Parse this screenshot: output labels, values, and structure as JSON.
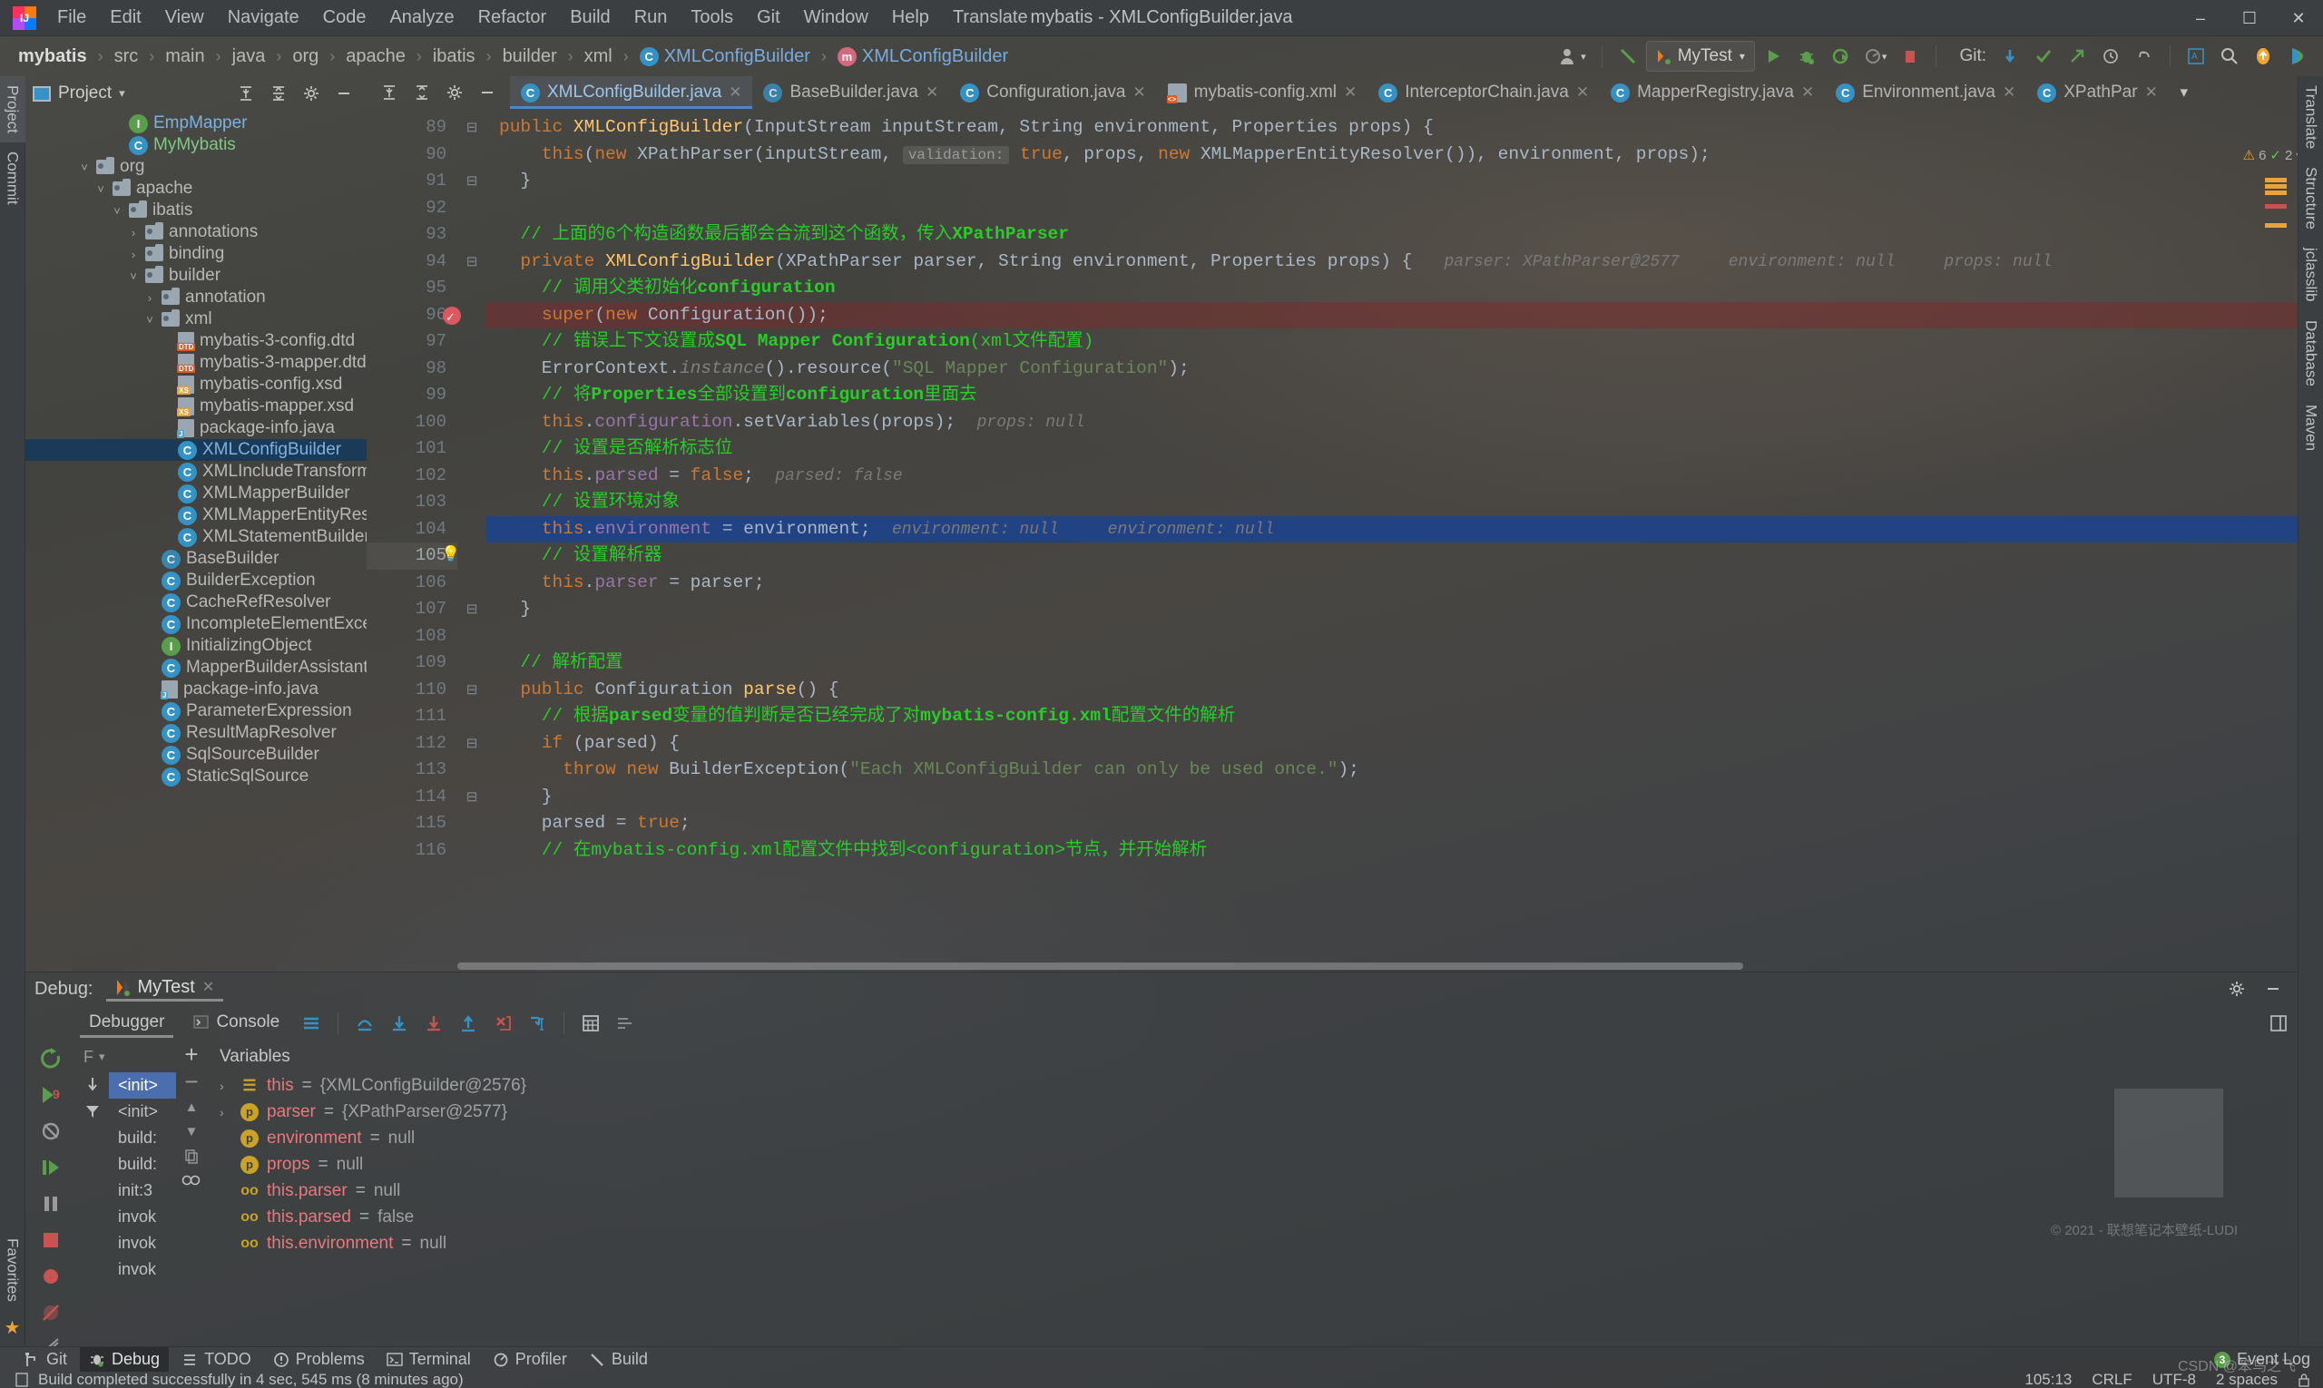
{
  "window": {
    "title": "mybatis - XMLConfigBuilder.java",
    "minimize": "–",
    "maximize": "☐",
    "close": "✕"
  },
  "menu": {
    "items": [
      "File",
      "Edit",
      "View",
      "Navigate",
      "Code",
      "Analyze",
      "Refactor",
      "Build",
      "Run",
      "Tools",
      "Git",
      "Window",
      "Help",
      "Translate"
    ]
  },
  "breadcrumb": {
    "items": [
      {
        "label": "mybatis",
        "kind": "project"
      },
      {
        "label": "src",
        "kind": "folder"
      },
      {
        "label": "main",
        "kind": "folder"
      },
      {
        "label": "java",
        "kind": "folder"
      },
      {
        "label": "org",
        "kind": "folder"
      },
      {
        "label": "apache",
        "kind": "folder"
      },
      {
        "label": "ibatis",
        "kind": "folder"
      },
      {
        "label": "builder",
        "kind": "folder"
      },
      {
        "label": "xml",
        "kind": "folder"
      },
      {
        "label": "XMLConfigBuilder",
        "kind": "class"
      },
      {
        "label": "XMLConfigBuilder",
        "kind": "method"
      }
    ]
  },
  "toolbar": {
    "run_config": "MyTest",
    "git_label": "Git:",
    "class_icon_letter": "C",
    "method_icon_letter": "m",
    "interface_icon_letter": "I"
  },
  "left_strip": {
    "tabs": [
      "Project",
      "Commit"
    ],
    "bottom_tabs": [
      "Favorites"
    ]
  },
  "right_strip": {
    "tabs": [
      "Translate",
      "Structure",
      "jclasslib",
      "Database",
      "Maven"
    ]
  },
  "project_panel": {
    "title": "Project",
    "tree": [
      {
        "indent": 5,
        "arrow": "",
        "icon": "interface",
        "label": "EmpMapper",
        "color": "blue"
      },
      {
        "indent": 5,
        "arrow": "",
        "icon": "run-class",
        "label": "MyMybatis",
        "color": "green"
      },
      {
        "indent": 3,
        "arrow": "v",
        "icon": "folder",
        "label": "org",
        "color": "plain"
      },
      {
        "indent": 4,
        "arrow": "v",
        "icon": "folder",
        "label": "apache",
        "color": "plain"
      },
      {
        "indent": 5,
        "arrow": "v",
        "icon": "folder",
        "label": "ibatis",
        "color": "plain"
      },
      {
        "indent": 6,
        "arrow": ">",
        "icon": "folder",
        "label": "annotations",
        "color": "plain"
      },
      {
        "indent": 6,
        "arrow": ">",
        "icon": "folder",
        "label": "binding",
        "color": "plain"
      },
      {
        "indent": 6,
        "arrow": "v",
        "icon": "folder",
        "label": "builder",
        "color": "plain"
      },
      {
        "indent": 7,
        "arrow": ">",
        "icon": "folder",
        "label": "annotation",
        "color": "plain"
      },
      {
        "indent": 7,
        "arrow": "v",
        "icon": "folder",
        "label": "xml",
        "color": "plain"
      },
      {
        "indent": 8,
        "arrow": "",
        "icon": "dtd",
        "label": "mybatis-3-config.dtd",
        "color": "plain"
      },
      {
        "indent": 8,
        "arrow": "",
        "icon": "dtd",
        "label": "mybatis-3-mapper.dtd",
        "color": "plain"
      },
      {
        "indent": 8,
        "arrow": "",
        "icon": "xsd",
        "label": "mybatis-config.xsd",
        "color": "plain"
      },
      {
        "indent": 8,
        "arrow": "",
        "icon": "xsd",
        "label": "mybatis-mapper.xsd",
        "color": "plain"
      },
      {
        "indent": 8,
        "arrow": "",
        "icon": "java-file",
        "label": "package-info.java",
        "color": "plain"
      },
      {
        "indent": 8,
        "arrow": "",
        "icon": "class",
        "label": "XMLConfigBuilder",
        "color": "blue",
        "selected": true
      },
      {
        "indent": 8,
        "arrow": "",
        "icon": "class",
        "label": "XMLIncludeTransformer",
        "color": "plain"
      },
      {
        "indent": 8,
        "arrow": "",
        "icon": "class",
        "label": "XMLMapperBuilder",
        "color": "plain"
      },
      {
        "indent": 8,
        "arrow": "",
        "icon": "class",
        "label": "XMLMapperEntityResolver",
        "color": "plain"
      },
      {
        "indent": 8,
        "arrow": "",
        "icon": "class",
        "label": "XMLStatementBuilder",
        "color": "plain"
      },
      {
        "indent": 7,
        "arrow": "",
        "icon": "abstract-class",
        "label": "BaseBuilder",
        "color": "plain"
      },
      {
        "indent": 7,
        "arrow": "",
        "icon": "class",
        "label": "BuilderException",
        "color": "plain"
      },
      {
        "indent": 7,
        "arrow": "",
        "icon": "class",
        "label": "CacheRefResolver",
        "color": "plain"
      },
      {
        "indent": 7,
        "arrow": "",
        "icon": "class",
        "label": "IncompleteElementException",
        "color": "plain"
      },
      {
        "indent": 7,
        "arrow": "",
        "icon": "interface",
        "label": "InitializingObject",
        "color": "plain"
      },
      {
        "indent": 7,
        "arrow": "",
        "icon": "class",
        "label": "MapperBuilderAssistant",
        "color": "plain"
      },
      {
        "indent": 7,
        "arrow": "",
        "icon": "java-file",
        "label": "package-info.java",
        "color": "plain"
      },
      {
        "indent": 7,
        "arrow": "",
        "icon": "class",
        "label": "ParameterExpression",
        "color": "plain"
      },
      {
        "indent": 7,
        "arrow": "",
        "icon": "class",
        "label": "ResultMapResolver",
        "color": "plain"
      },
      {
        "indent": 7,
        "arrow": "",
        "icon": "class",
        "label": "SqlSourceBuilder",
        "color": "plain"
      },
      {
        "indent": 7,
        "arrow": "",
        "icon": "class",
        "label": "StaticSqlSource",
        "color": "plain"
      }
    ]
  },
  "editor": {
    "tabs": [
      {
        "label": "XMLConfigBuilder.java",
        "icon": "class",
        "active": true
      },
      {
        "label": "BaseBuilder.java",
        "icon": "abstract-class",
        "active": false
      },
      {
        "label": "Configuration.java",
        "icon": "class",
        "active": false
      },
      {
        "label": "mybatis-config.xml",
        "icon": "xml",
        "active": false
      },
      {
        "label": "InterceptorChain.java",
        "icon": "class",
        "active": false
      },
      {
        "label": "MapperRegistry.java",
        "icon": "class",
        "active": false
      },
      {
        "label": "Environment.java",
        "icon": "class",
        "active": false
      },
      {
        "label": "XPathPar",
        "icon": "class",
        "active": false
      }
    ],
    "inspection": {
      "warnings": "6",
      "errors": "2",
      "warn_symbol": "⚠",
      "ok_symbol": "✓"
    },
    "first_line_number": 89,
    "lines": [
      {
        "n": 89,
        "fold": "⊟",
        "html": "<span class=\"kw\">public</span> <span class=\"cls2\">XMLConfigBuilder</span>(InputStream inputStream, String environment, Properties props) {"
      },
      {
        "n": 90,
        "fold": "",
        "html": "    <span class=\"kw\">this</span>(<span class=\"kw\">new</span> XPathParser(inputStream, <span class=\"hint\">validation:</span> <span class=\"kw\">true</span>, props, <span class=\"kw\">new</span> XMLMapperEntityResolver()), environment, props);"
      },
      {
        "n": 91,
        "fold": "⊟",
        "html": "  }"
      },
      {
        "n": 92,
        "fold": "",
        "html": ""
      },
      {
        "n": 93,
        "fold": "",
        "html": "  <span class=\"cmt\">// 上面的6个构造函数最后都会合流到这个函数，传入<b>XPathParser</b></span>"
      },
      {
        "n": 94,
        "fold": "⊟",
        "html": "  <span class=\"kw\">private</span> <span class=\"cls2\">XMLConfigBuilder</span>(XPathParser parser, String environment, Properties props) {   <span class=\"paramhint\">parser: XPathParser@2577     environment: null     props: null</span>"
      },
      {
        "n": 95,
        "fold": "",
        "html": "    <span class=\"cmt\">// 调用父类初始化<b>configuration</b></span>"
      },
      {
        "n": 96,
        "fold": "",
        "bp": true,
        "hl": "red",
        "html": "    <span class=\"kw\">super</span>(<span class=\"kw\">new</span> Configuration());"
      },
      {
        "n": 97,
        "fold": "",
        "html": "    <span class=\"cmt\">// 错误上下文设置成<b>SQL Mapper Configuration</b>(xml文件配置)</span>"
      },
      {
        "n": 98,
        "fold": "",
        "html": "    ErrorContext.<span class=\"ital\">instance</span>().resource(<span class=\"str\">\"SQL Mapper Configuration\"</span>);"
      },
      {
        "n": 99,
        "fold": "",
        "html": "    <span class=\"cmt\">// 将<b>Properties</b>全部设置到<b>configuration</b>里面去</span>"
      },
      {
        "n": 100,
        "fold": "",
        "html": "    <span class=\"kw\">this</span>.<span class=\"fld\">configuration</span>.setVariables(props);  <span class=\"paramhint\">props: null</span>"
      },
      {
        "n": 101,
        "fold": "",
        "html": "    <span class=\"cmt\">// 设置是否解析标志位</span>"
      },
      {
        "n": 102,
        "fold": "",
        "html": "    <span class=\"kw\">this</span>.<span class=\"fld\">parsed</span> = <span class=\"kw\">false</span>;  <span class=\"paramhint\">parsed: false</span>"
      },
      {
        "n": 103,
        "fold": "",
        "html": "    <span class=\"cmt\">// 设置环境对象</span>"
      },
      {
        "n": 104,
        "fold": "",
        "hl": "blue",
        "html": "    <span class=\"kw\">this</span>.<span class=\"fld\">environment</span> = environment;  <span class=\"paramhint\">environment: null     environment: null</span>"
      },
      {
        "n": 105,
        "fold": "",
        "bulb": true,
        "cur": true,
        "html": "    <span class=\"cmt\">// 设置解析器</span>"
      },
      {
        "n": 106,
        "fold": "",
        "html": "    <span class=\"kw\">this</span>.<span class=\"fld\">parser</span> = parser;"
      },
      {
        "n": 107,
        "fold": "⊟",
        "html": "  }"
      },
      {
        "n": 108,
        "fold": "",
        "html": ""
      },
      {
        "n": 109,
        "fold": "",
        "html": "  <span class=\"cmt\">// 解析配置</span>"
      },
      {
        "n": 110,
        "fold": "⊟",
        "html": "  <span class=\"kw\">public</span> Configuration <span class=\"mth\">parse</span>() {"
      },
      {
        "n": 111,
        "fold": "",
        "html": "    <span class=\"cmt\">// 根据<b>parsed</b>变量的值判断是否已经完成了对<b>mybatis-config.xml</b>配置文件的解析</span>"
      },
      {
        "n": 112,
        "fold": "⊟",
        "html": "    <span class=\"kw\">if</span> (parsed) {"
      },
      {
        "n": 113,
        "fold": "",
        "html": "      <span class=\"kw\">throw new</span> BuilderException(<span class=\"str\">\"Each XMLConfigBuilder can only be used once.\"</span>);"
      },
      {
        "n": 114,
        "fold": "⊟",
        "html": "    }"
      },
      {
        "n": 115,
        "fold": "",
        "html": "    parsed = <span class=\"kw\">true</span>;"
      },
      {
        "n": 116,
        "fold": "",
        "html": "    <span class=\"cmt\">// 在mybatis-config.xml配置文件中找到&lt;configuration&gt;节点，并开始解析</span>"
      }
    ]
  },
  "debug": {
    "label": "Debug:",
    "session": "MyTest",
    "tabs": [
      {
        "label": "Debugger",
        "active": true
      },
      {
        "label": "Console",
        "active": false
      }
    ],
    "frames_head": "F",
    "frames": [
      {
        "label": "<init>",
        "selected": true
      },
      {
        "label": "<init>",
        "selected": false
      },
      {
        "label": "build:",
        "selected": false
      },
      {
        "label": "build:",
        "selected": false
      },
      {
        "label": "init:3",
        "selected": false
      },
      {
        "label": "invok",
        "selected": false
      },
      {
        "label": "invok",
        "selected": false
      },
      {
        "label": "invok",
        "selected": false
      }
    ],
    "variables_header": "Variables",
    "variables": [
      {
        "arrow": ">",
        "icon": "field",
        "name": "this",
        "eq": " = ",
        "value": "{XMLConfigBuilder@2576}"
      },
      {
        "arrow": ">",
        "icon": "param",
        "name": "parser",
        "eq": " = ",
        "value": "{XPathParser@2577}"
      },
      {
        "arrow": "",
        "icon": "param",
        "name": "environment",
        "eq": " = ",
        "value": "null"
      },
      {
        "arrow": "",
        "icon": "param",
        "name": "props",
        "eq": " = ",
        "value": "null"
      },
      {
        "arrow": "",
        "icon": "oo",
        "name": "this.parser",
        "eq": " = ",
        "value": "null"
      },
      {
        "arrow": "",
        "icon": "oo",
        "name": "this.parsed",
        "eq": " = ",
        "value": "false"
      },
      {
        "arrow": "",
        "icon": "oo",
        "name": "this.environment",
        "eq": " = ",
        "value": "null"
      }
    ]
  },
  "toolwindow_bar": {
    "items": [
      {
        "label": "Git",
        "icon": "branch-icon",
        "active": false
      },
      {
        "label": "Debug",
        "icon": "bug-icon",
        "active": true
      },
      {
        "label": "TODO",
        "icon": "list-icon",
        "active": false
      },
      {
        "label": "Problems",
        "icon": "warning-icon",
        "active": false
      },
      {
        "label": "Terminal",
        "icon": "terminal-icon",
        "active": false
      },
      {
        "label": "Profiler",
        "icon": "profiler-icon",
        "active": false
      },
      {
        "label": "Build",
        "icon": "hammer-icon",
        "active": false
      }
    ],
    "event_log": "Event Log",
    "event_count": "3"
  },
  "status_bar": {
    "message": "Build completed successfully in 4 sec, 545 ms (8 minutes ago)",
    "caret": "105:13",
    "line_sep": "CRLF",
    "encoding": "UTF-8",
    "indent": "2 spaces",
    "watermark": "CSDN @笨鸟之飞"
  },
  "watermark": {
    "text": "© 2021 - 联想笔记本壁纸-LUDI"
  },
  "colors": {
    "accent_blue": "#3592c4",
    "selection_blue": "#214283",
    "tree_selection": "#1b3a58",
    "comment_green": "#29cc29",
    "keyword_orange": "#cc7832",
    "string_green": "#6a8759",
    "breakpoint_red": "#db5860",
    "panel_bg": "#3c3f41"
  }
}
